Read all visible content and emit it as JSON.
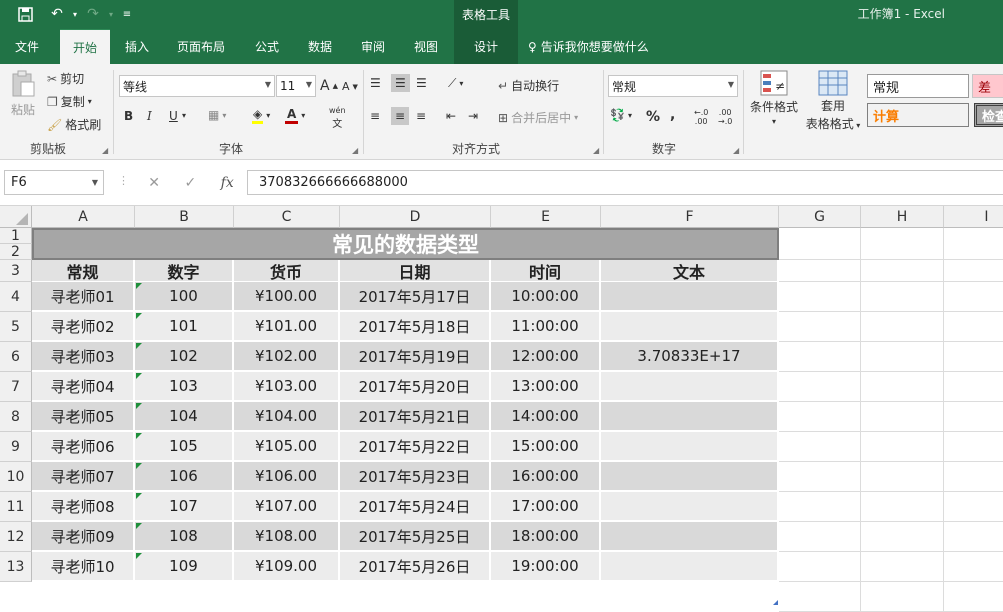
{
  "title_bar": {
    "context_tab_title": "表格工具",
    "window_title": "工作簿1  -  Excel"
  },
  "tabs": [
    "文件",
    "开始",
    "插入",
    "页面布局",
    "公式",
    "数据",
    "审阅",
    "视图",
    "设计"
  ],
  "tell_me": "告诉我你想要做什么",
  "ribbon": {
    "paste": "粘贴",
    "cut": "剪切",
    "copy": "复制",
    "format_painter": "格式刷",
    "clipboard_group": "剪贴板",
    "font_name": "等线",
    "font_size": "11",
    "font_group": "字体",
    "bold": "B",
    "italic": "I",
    "underline": "U",
    "wrap_text": "自动换行",
    "merge_center": "合并后居中",
    "align_group": "对齐方式",
    "number_format": "常规",
    "number_group": "数字",
    "conditional_format": "条件格式",
    "table_format_1": "套用",
    "table_format_2": "表格格式",
    "styles": [
      "常规",
      "差",
      "计算",
      "检查"
    ]
  },
  "formula_bar": {
    "name_box": "F6",
    "formula": "370832666666688000"
  },
  "sheet": {
    "columns": [
      "A",
      "B",
      "C",
      "D",
      "E",
      "F",
      "G",
      "H",
      "I"
    ],
    "rows": [
      "1",
      "2",
      "3",
      "4",
      "5",
      "6",
      "7",
      "8",
      "9",
      "10",
      "11",
      "12",
      "13"
    ],
    "title": "常见的数据类型",
    "headers": [
      "常规",
      "数字",
      "货币",
      "日期",
      "时间",
      "文本"
    ],
    "records": [
      [
        "寻老师01",
        "100",
        "¥100.00",
        "2017年5月17日",
        "10:00:00",
        ""
      ],
      [
        "寻老师02",
        "101",
        "¥101.00",
        "2017年5月18日",
        "11:00:00",
        ""
      ],
      [
        "寻老师03",
        "102",
        "¥102.00",
        "2017年5月19日",
        "12:00:00",
        "3.70833E+17"
      ],
      [
        "寻老师04",
        "103",
        "¥103.00",
        "2017年5月20日",
        "13:00:00",
        ""
      ],
      [
        "寻老师05",
        "104",
        "¥104.00",
        "2017年5月21日",
        "14:00:00",
        ""
      ],
      [
        "寻老师06",
        "105",
        "¥105.00",
        "2017年5月22日",
        "15:00:00",
        ""
      ],
      [
        "寻老师07",
        "106",
        "¥106.00",
        "2017年5月23日",
        "16:00:00",
        ""
      ],
      [
        "寻老师08",
        "107",
        "¥107.00",
        "2017年5月24日",
        "17:00:00",
        ""
      ],
      [
        "寻老师09",
        "108",
        "¥108.00",
        "2017年5月25日",
        "18:00:00",
        ""
      ],
      [
        "寻老师10",
        "109",
        "¥109.00",
        "2017年5月26日",
        "19:00:00",
        ""
      ]
    ]
  },
  "colors": {
    "excel_green": "#217346",
    "title_band": "#a6a6a6",
    "header_band": "#e2e2e2",
    "row_dark": "#d9d9d9",
    "row_light": "#ececec"
  }
}
